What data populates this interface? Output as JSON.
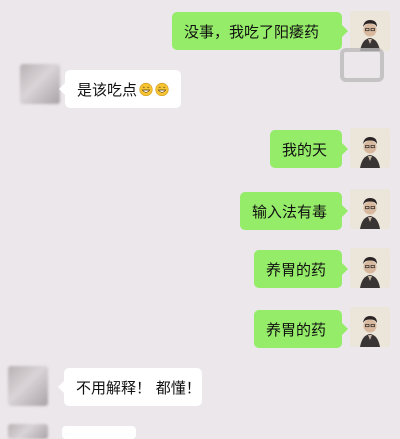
{
  "messages": [
    {
      "side": "out",
      "text": "没事，我吃了阳痿药"
    },
    {
      "side": "in",
      "text": "是该吃点",
      "emoji": [
        "grin-icon",
        "grin-icon"
      ]
    },
    {
      "side": "out",
      "text": "我的天"
    },
    {
      "side": "out",
      "text": "输入法有毒"
    },
    {
      "side": "out",
      "text": "养胃的药"
    },
    {
      "side": "out",
      "text": "养胃的药"
    },
    {
      "side": "in",
      "text": "不用解释！ 都懂！"
    }
  ],
  "colors": {
    "background": "#ebe7ea",
    "outgoing_bubble": "#95ec69",
    "incoming_bubble": "#ffffff"
  }
}
